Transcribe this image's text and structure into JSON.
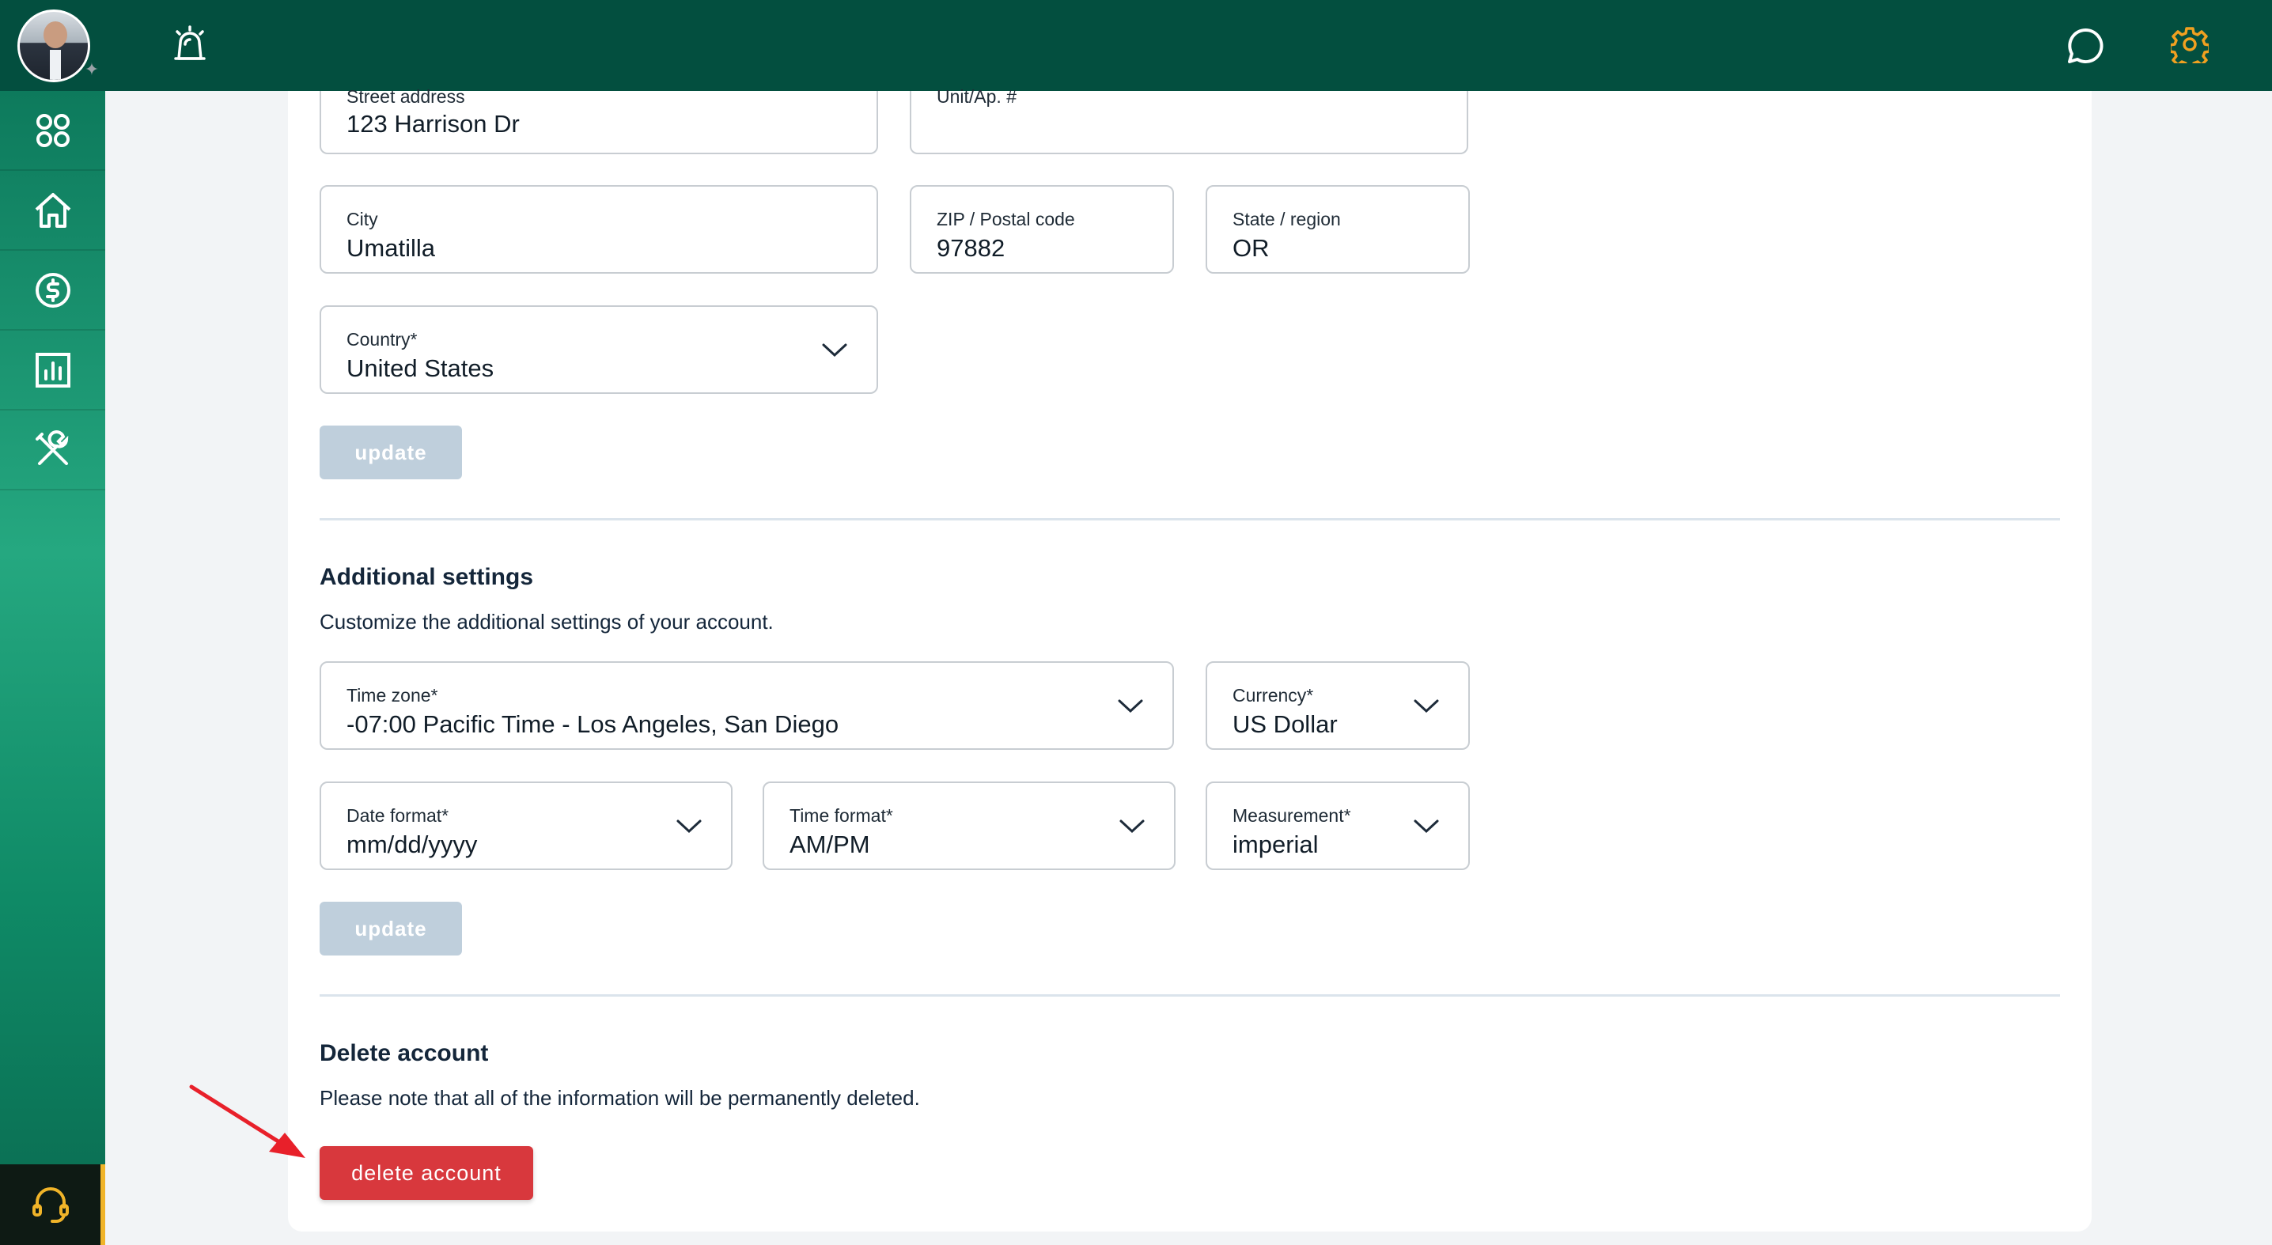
{
  "colors": {
    "topbar": "#034f3f",
    "sidebar_accent": "#25a880",
    "gear_accent": "#f0a020",
    "update_button": "#bfcfdc",
    "delete_button": "#d8383d",
    "arrow": "#e8202a"
  },
  "topbar": {
    "icons": [
      "alarm-icon",
      "chat-icon",
      "gear-icon"
    ]
  },
  "sidebar": {
    "items": [
      {
        "icon": "apps-grid-icon"
      },
      {
        "icon": "home-icon"
      },
      {
        "icon": "dollar-icon"
      },
      {
        "icon": "chart-icon"
      },
      {
        "icon": "tools-icon"
      }
    ],
    "support_icon": "headset-icon"
  },
  "address": {
    "street": {
      "label": "Street address",
      "value": "123 Harrison Dr"
    },
    "unit": {
      "label": "Unit/Ap. #",
      "value": ""
    },
    "city": {
      "label": "City",
      "value": "Umatilla"
    },
    "zip": {
      "label": "ZIP / Postal code",
      "value": "97882"
    },
    "state": {
      "label": "State / region",
      "value": "OR"
    },
    "country": {
      "label": "Country*",
      "value": "United States"
    },
    "update_label": "update"
  },
  "additional": {
    "title": "Additional settings",
    "description": "Customize the additional settings of your account.",
    "timezone": {
      "label": "Time zone*",
      "value": "-07:00 Pacific Time - Los Angeles, San Diego"
    },
    "currency": {
      "label": "Currency*",
      "value": "US Dollar"
    },
    "date_format": {
      "label": "Date format*",
      "value": "mm/dd/yyyy"
    },
    "time_format": {
      "label": "Time format*",
      "value": "AM/PM"
    },
    "measurement": {
      "label": "Measurement*",
      "value": "imperial"
    },
    "update_label": "update"
  },
  "delete": {
    "title": "Delete account",
    "description": "Please note that all of the information will be permanently deleted.",
    "button_label": "delete account"
  }
}
